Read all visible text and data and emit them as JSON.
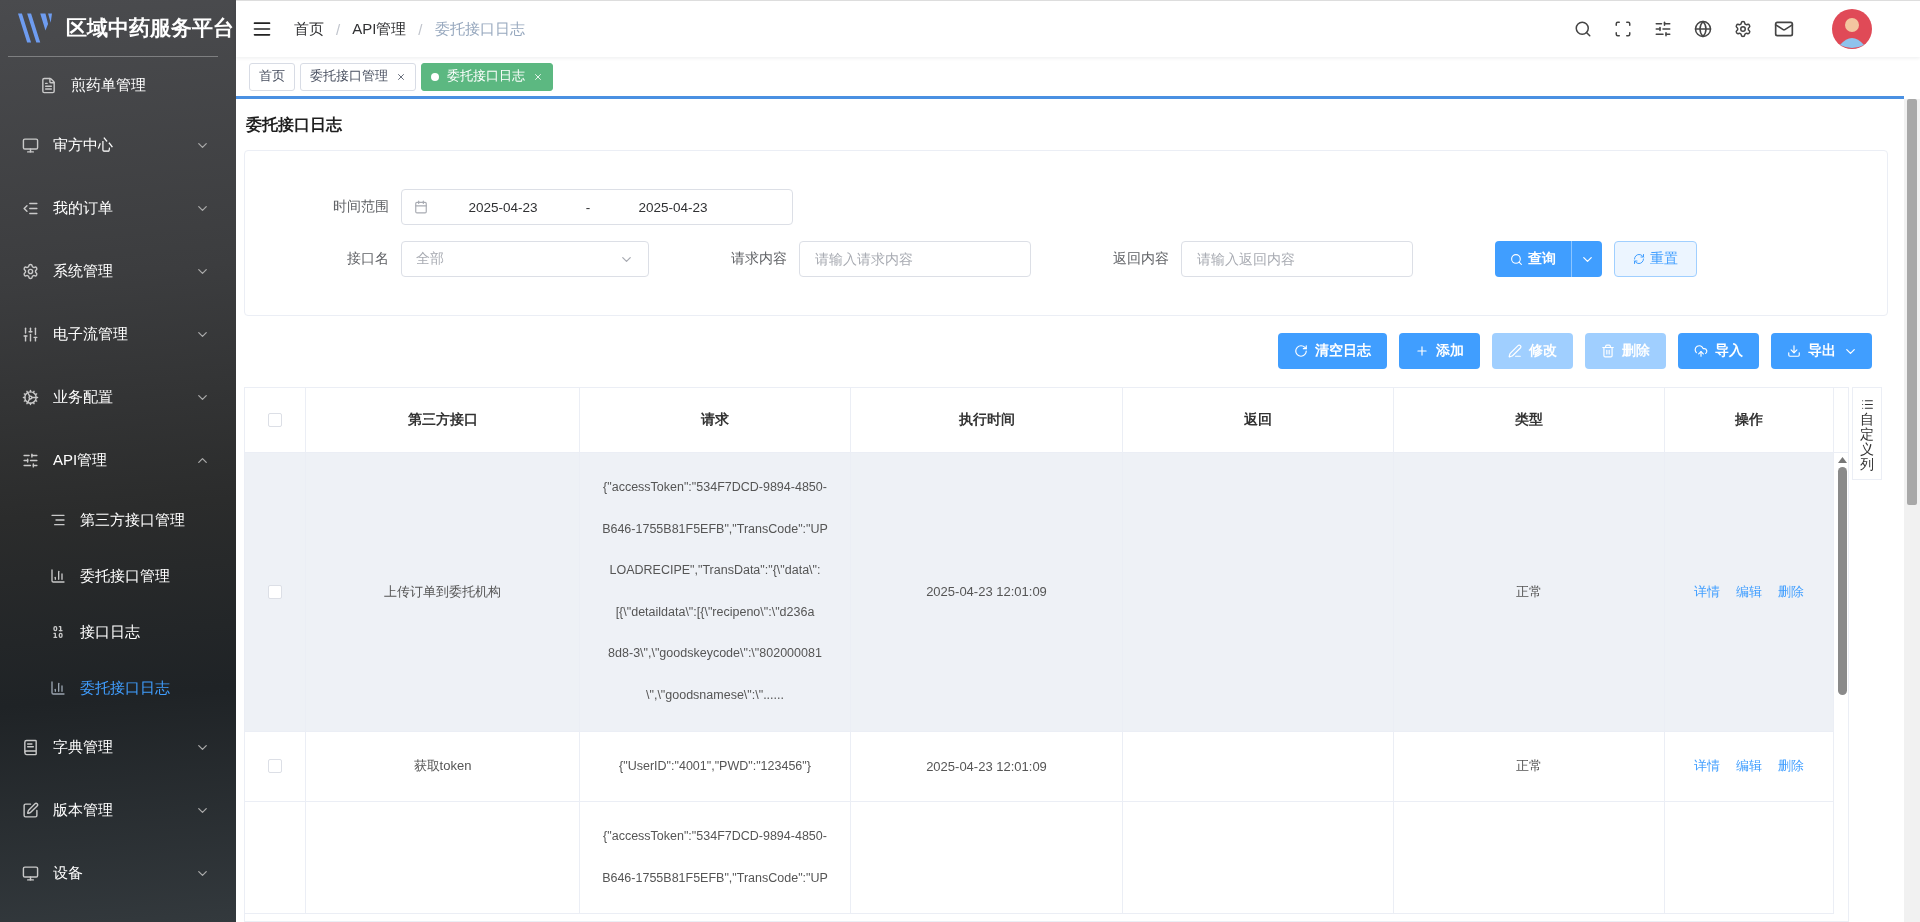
{
  "sidebar": {
    "title": "区域中药服务平台",
    "items": [
      {
        "label": "煎药单管理",
        "kind": "sub",
        "selected": false
      },
      {
        "label": "审方中心",
        "kind": "group",
        "expanded": false,
        "selected": false
      },
      {
        "label": "我的订单",
        "kind": "group",
        "expanded": false,
        "selected": false
      },
      {
        "label": "系统管理",
        "kind": "group",
        "expanded": false,
        "selected": false
      },
      {
        "label": "电子流管理",
        "kind": "group",
        "expanded": false,
        "selected": false
      },
      {
        "label": "业务配置",
        "kind": "group",
        "expanded": false,
        "selected": false
      },
      {
        "label": "API管理",
        "kind": "group",
        "expanded": true,
        "selected": false,
        "children": [
          {
            "label": "第三方接口管理",
            "selected": false
          },
          {
            "label": "委托接口管理",
            "selected": false
          },
          {
            "label": "接口日志",
            "selected": false
          },
          {
            "label": "委托接口日志",
            "selected": true
          }
        ]
      },
      {
        "label": "字典管理",
        "kind": "group",
        "expanded": false,
        "selected": false
      },
      {
        "label": "版本管理",
        "kind": "group",
        "expanded": false,
        "selected": false
      },
      {
        "label": "设备",
        "kind": "group",
        "expanded": false,
        "selected": false
      }
    ]
  },
  "header": {
    "breadcrumb": [
      "首页",
      "API管理",
      "委托接口日志"
    ],
    "breadcrumb_separators": [
      "/",
      "/"
    ]
  },
  "tabs": [
    {
      "label": "首页",
      "selected": false,
      "closable": false
    },
    {
      "label": "委托接口管理",
      "selected": false,
      "closable": true
    },
    {
      "label": "委托接口日志",
      "selected": true,
      "closable": true
    }
  ],
  "page_title": "委托接口日志",
  "filters": {
    "time_range": {
      "label": "时间范围",
      "start": "2025-04-23",
      "separator": "-",
      "end": "2025-04-23"
    },
    "fields": [
      {
        "kind": "select",
        "label": "接口名",
        "placeholder": "全部"
      },
      {
        "kind": "input",
        "label": "请求内容",
        "placeholder": "请输入请求内容"
      },
      {
        "kind": "input",
        "label": "返回内容",
        "placeholder": "请输入返回内容"
      }
    ],
    "query_button": "查询",
    "reset_button": "重置"
  },
  "toolbar": [
    {
      "label": "清空日志",
      "disabled": false,
      "dropdown": false
    },
    {
      "label": "添加",
      "disabled": false,
      "dropdown": false
    },
    {
      "label": "修改",
      "disabled": true,
      "dropdown": false
    },
    {
      "label": "删除",
      "disabled": true,
      "dropdown": false
    },
    {
      "label": "导入",
      "disabled": false,
      "dropdown": false
    },
    {
      "label": "导出",
      "disabled": false,
      "dropdown": true
    }
  ],
  "table": {
    "header_checked": false,
    "columns": [
      "第三方接口",
      "请求",
      "执行时间",
      "返回",
      "类型",
      "操作"
    ],
    "rows": [
      {
        "checked": false,
        "highlighted": true,
        "interface": "上传订单到委托机构",
        "request_lines": [
          "{\"accessToken\":\"534F7DCD-9894-4850-",
          "B646-1755B81F5EFB\",\"TransCode\":\"UP",
          "LOADRECIPE\",\"TransData\":\"{\\\"data\\\":",
          "[{\\\"detaildata\\\":[{\\\"recipeno\\\":\\\"d236a",
          "8d8-3\\\",\\\"goodskeycode\\\":\\\"802000081",
          "\\\",\\\"goodsnamese\\\":\\\"......"
        ],
        "time": "2025-04-23 12:01:09",
        "type": "正常",
        "actions": [
          "详情",
          "编辑",
          "删除"
        ]
      },
      {
        "checked": false,
        "highlighted": false,
        "interface": "获取token",
        "request_lines": [
          "{\"UserID\":\"4001\",\"PWD\":\"123456\"}"
        ],
        "time": "2025-04-23 12:01:09",
        "type": "正常",
        "actions": [
          "详情",
          "编辑",
          "删除"
        ]
      },
      {
        "request_lines": [
          "{\"accessToken\":\"534F7DCD-9894-4850-",
          "B646-1755B81F5EFB\",\"TransCode\":\"UP"
        ]
      }
    ]
  },
  "column_settings": "自定义列"
}
